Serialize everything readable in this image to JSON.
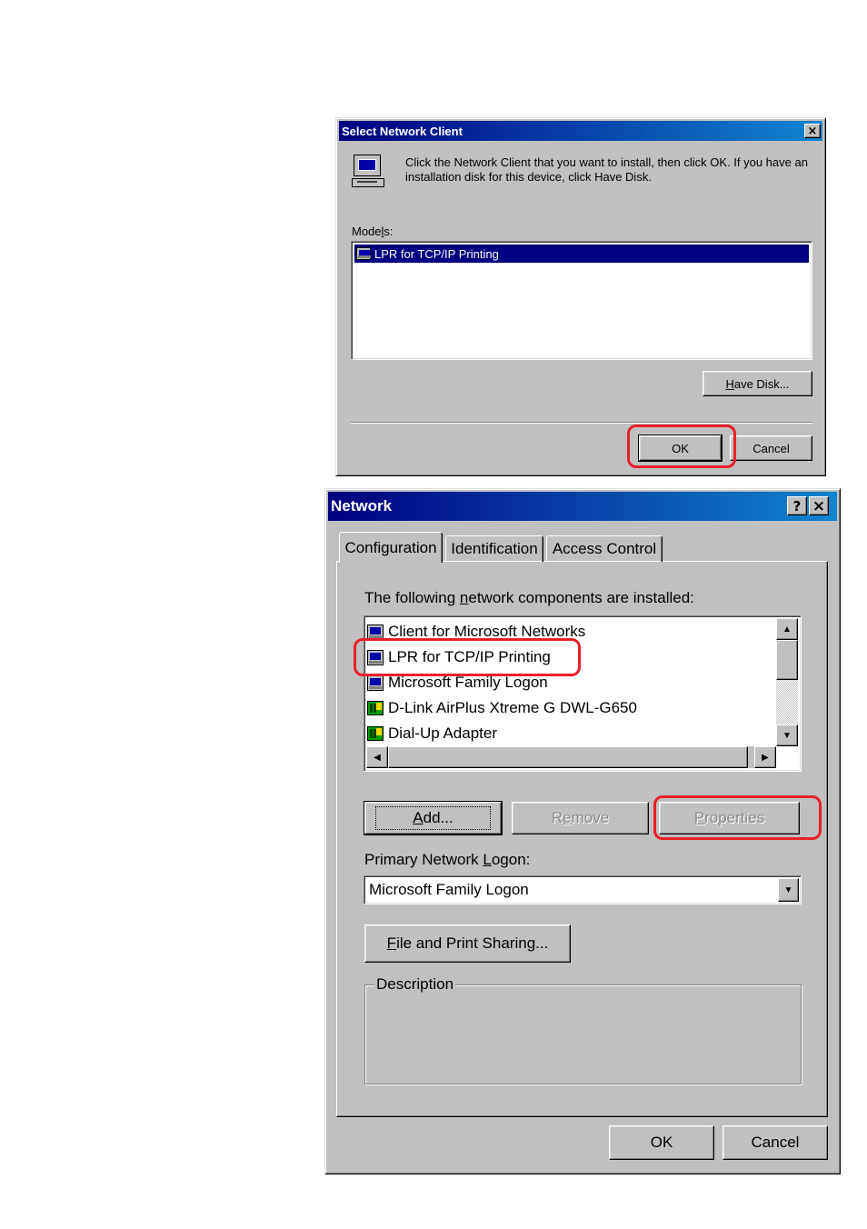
{
  "select_dialog": {
    "title": "Select Network Client",
    "close_symbol": "×",
    "instruction": "Click the Network Client that you want to install, then click OK. If you have an installation disk for this device, click Have Disk.",
    "models_label": "Models:",
    "models": [
      "LPR for TCP/IP Printing"
    ],
    "have_disk_label": "Have Disk...",
    "ok_label": "OK",
    "cancel_label": "Cancel"
  },
  "network_dialog": {
    "title": "Network",
    "help_symbol": "?",
    "close_symbol": "×",
    "tabs": [
      "Configuration",
      "Identification",
      "Access Control"
    ],
    "active_tab": "Configuration",
    "components_label": "The following network components are installed:",
    "components": [
      {
        "label": "Client for Microsoft Networks",
        "icon": "client-icon"
      },
      {
        "label": "LPR for TCP/IP Printing",
        "icon": "client-icon"
      },
      {
        "label": "Microsoft Family Logon",
        "icon": "client-icon"
      },
      {
        "label": "D-Link AirPlus Xtreme G DWL-G650",
        "icon": "network-adapter-icon"
      },
      {
        "label": "Dial-Up Adapter",
        "icon": "network-adapter-icon"
      }
    ],
    "add_label": "Add...",
    "remove_label": "Remove",
    "properties_label": "Properties",
    "primary_logon_label": "Primary Network Logon:",
    "primary_logon_value": "Microsoft Family Logon",
    "file_print_label": "File and Print Sharing...",
    "description_label": "Description",
    "ok_label": "OK",
    "cancel_label": "Cancel"
  },
  "highlight_color": "#e8202a"
}
